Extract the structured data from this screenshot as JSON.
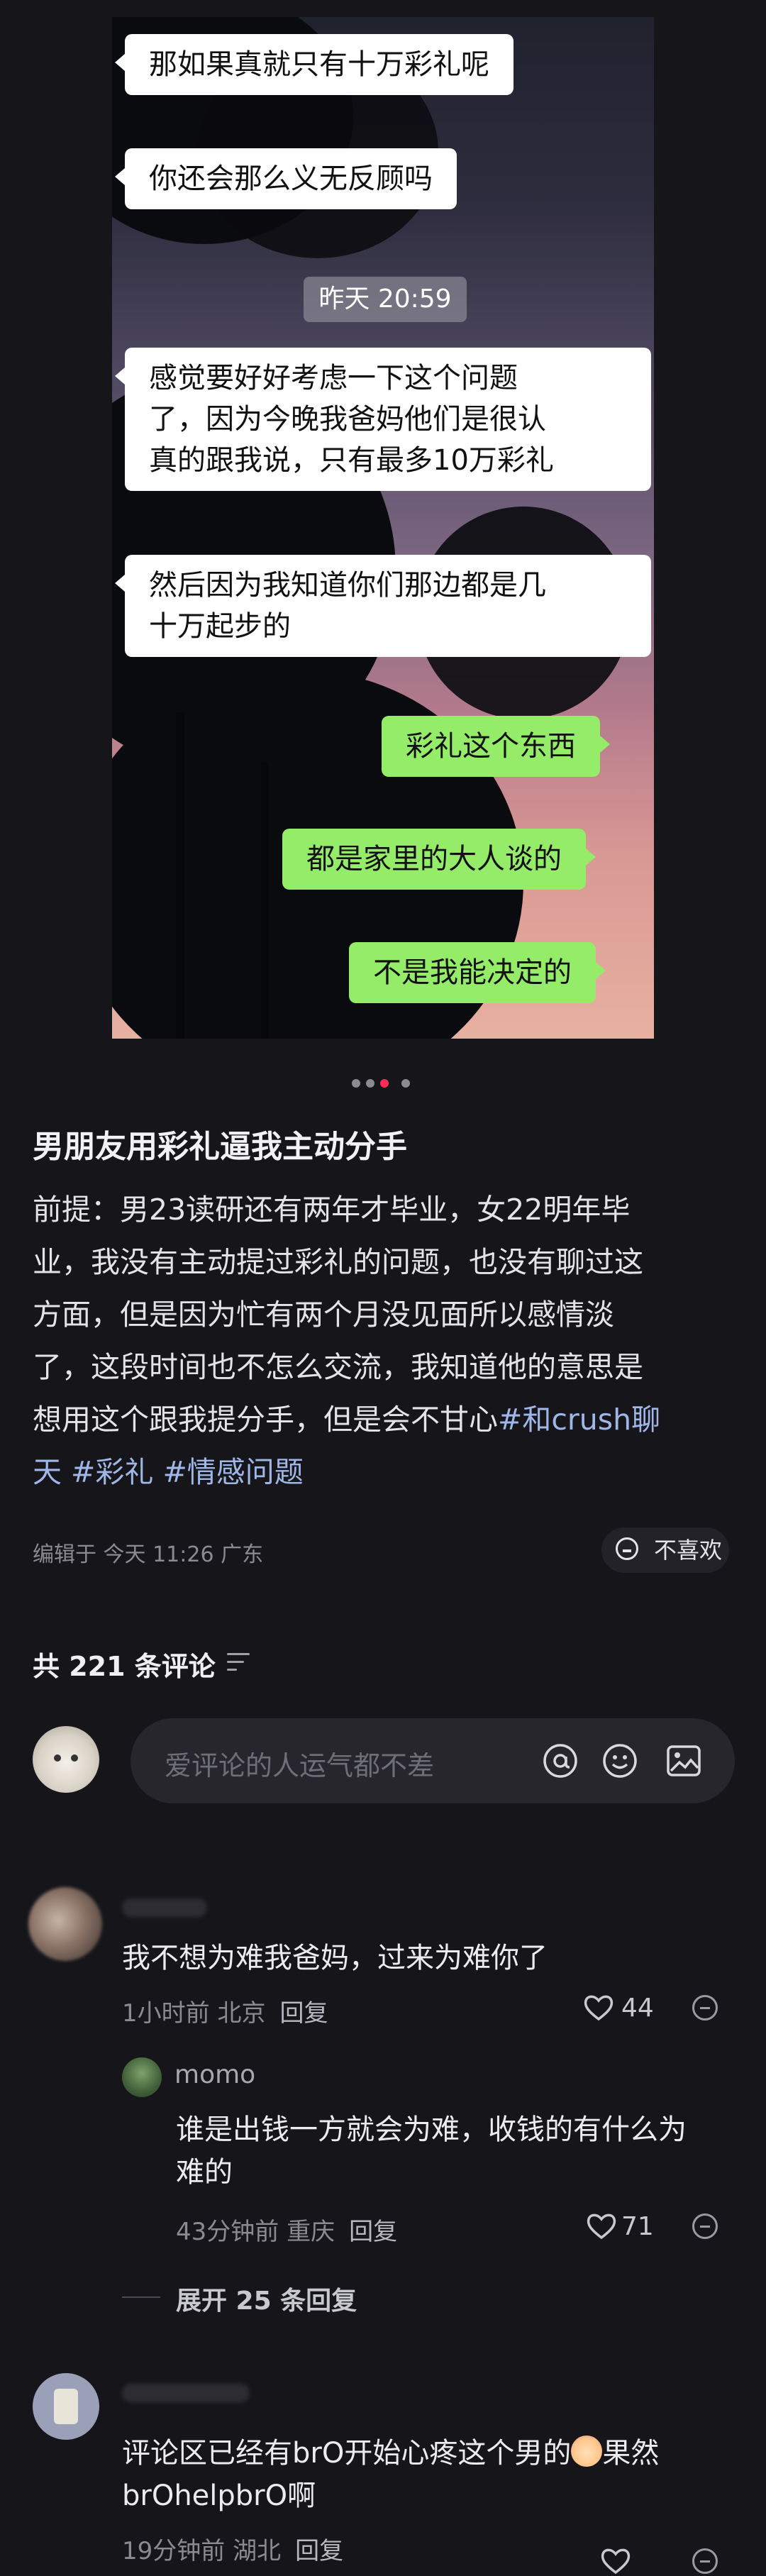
{
  "chat": {
    "messages": [
      {
        "side": "in",
        "text": "那如果真就只有十万彩礼呢"
      },
      {
        "side": "in",
        "text": "你还会那么义无反顾吗"
      },
      {
        "side": "in",
        "lines": [
          "感觉要好好考虑一下这个问题",
          "了，因为今晚我爸妈他们是很认",
          "真的跟我说，只有最多10万彩礼"
        ]
      },
      {
        "side": "in",
        "lines": [
          "然后因为我知道你们那边都是几",
          "十万起步的"
        ]
      },
      {
        "side": "out",
        "text": "彩礼这个东西"
      },
      {
        "side": "out",
        "text": "都是家里的大人谈的"
      },
      {
        "side": "out",
        "text": "不是我能决定的"
      }
    ],
    "timestamp": "昨天 20:59"
  },
  "pager": {
    "total": 4,
    "active": 2
  },
  "post": {
    "title": "男朋友用彩礼逼我主动分手",
    "body_lines": [
      "前提：男23读研还有两年才毕业，女22明年毕",
      "业，我没有主动提过彩礼的问题，也没有聊过这",
      "方面，但是因为忙有两个月没见面所以感情淡",
      "了，这段时间也不怎么交流，我知道他的意思是",
      "想用这个跟我提分手，但是会不甘心"
    ],
    "tags": [
      "#和crush聊",
      "天",
      "#彩礼",
      "#情感问题"
    ],
    "meta": "编辑于 今天 11:26 广东",
    "dislike_label": "不喜欢"
  },
  "comments_header": {
    "count_label": "共 221 条评论"
  },
  "comment_input": {
    "placeholder": "爱评论的人运气都不差"
  },
  "comments": [
    {
      "text": "我不想为难我爸妈，过来为难你了",
      "time": "1小时前 北京",
      "reply_label": "回复",
      "likes": "44"
    },
    {
      "author": "momo",
      "lines": [
        "谁是出钱一方就会为难，收钱的有什么为",
        "难的"
      ],
      "time": "43分钟前 重庆",
      "reply_label": "回复",
      "likes": "71"
    },
    {
      "lines": [
        "评论区已经有brO开始心疼这个男的",
        "果然",
        "brOhelpbrO啊"
      ],
      "time": "19分钟前 湖北",
      "reply_label": "回复"
    }
  ],
  "expand_replies": "展开 25 条回复",
  "colors": {
    "accent": "#ff2d55",
    "incoming_bubble": "#ffffff",
    "outgoing_bubble": "#95ec69",
    "background": "#16161a"
  }
}
